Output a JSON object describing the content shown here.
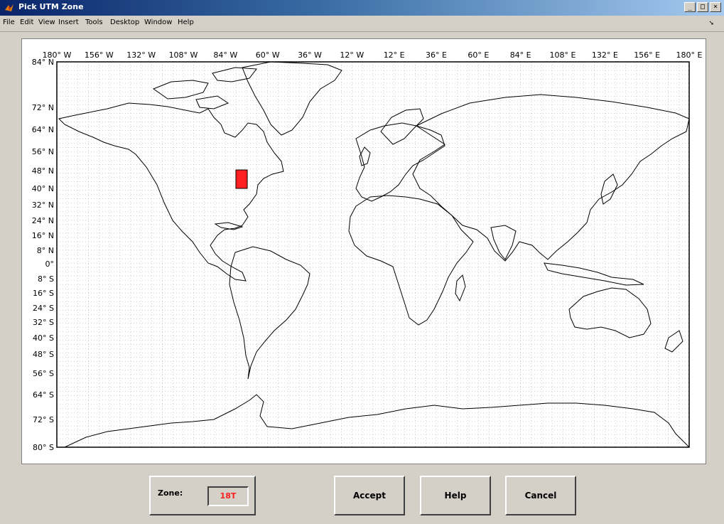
{
  "window": {
    "title": "Pick UTM Zone",
    "buttons": [
      "_",
      "□",
      "×"
    ]
  },
  "menu": [
    "File",
    "Edit",
    "View",
    "Insert",
    "Tools",
    "Desktop",
    "Window",
    "Help"
  ],
  "map": {
    "lon_labels": [
      "180° W",
      "156° W",
      "132° W",
      "108° W",
      "84° W",
      "60° W",
      "36° W",
      "12° W",
      "12° E",
      "36° E",
      "60° E",
      "84° E",
      "108° E",
      "132° E",
      "156° E",
      "180° E"
    ],
    "lat_labels": [
      "84° N",
      "72° N",
      "64° N",
      "56° N",
      "48° N",
      "40° N",
      "32° N",
      "24° N",
      "16° N",
      "8° N",
      "0°",
      "8° S",
      "16° S",
      "24° S",
      "32° S",
      "40° S",
      "48° S",
      "56° S",
      "64° S",
      "72° S",
      "80° S"
    ],
    "selected_zone_color": "#ff2020"
  },
  "zone": {
    "label": "Zone:",
    "value": "18T"
  },
  "buttons": {
    "accept": "Accept",
    "help": "Help",
    "cancel": "Cancel"
  }
}
